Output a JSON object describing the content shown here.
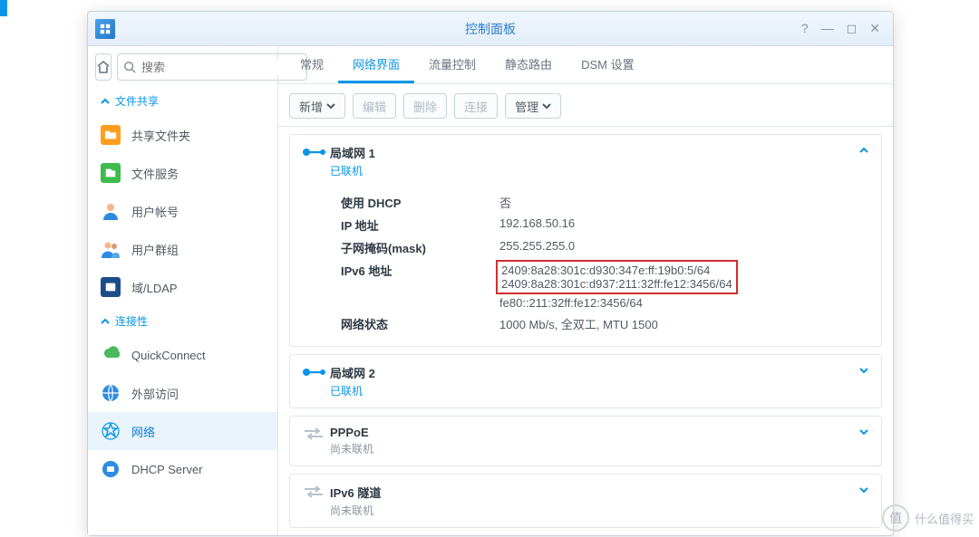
{
  "title": "控制面板",
  "search_placeholder": "搜索",
  "categories": {
    "file_sharing": "文件共享",
    "connectivity": "连接性"
  },
  "sidebar": {
    "shared_folder": "共享文件夹",
    "file_services": "文件服务",
    "user_account": "用户帐号",
    "user_group": "用户群组",
    "domain_ldap": "域/LDAP",
    "quickconnect": "QuickConnect",
    "external_access": "外部访问",
    "network": "网络",
    "dhcp_server": "DHCP Server"
  },
  "tabs": {
    "general": "常规",
    "iface": "网络界面",
    "traffic": "流量控制",
    "static_route": "静态路由",
    "dsm_settings": "DSM 设置"
  },
  "toolbar": {
    "add": "新增",
    "edit": "编辑",
    "delete": "删除",
    "connect": "连接",
    "manage": "管理"
  },
  "lan1": {
    "title": "局域网 1",
    "status": "已联机",
    "labels": {
      "dhcp": "使用 DHCP",
      "ip": "IP 地址",
      "mask": "子网掩码(mask)",
      "ipv6": "IPv6 地址",
      "netstat": "网络状态"
    },
    "dhcp": "否",
    "ip": "192.168.50.16",
    "mask": "255.255.255.0",
    "ipv6_1": "2409:8a28:301c:d930:347e:ff:19b0:5/64",
    "ipv6_2": "2409:8a28:301c:d937:211:32ff:fe12:3456/64",
    "ipv6_3": "fe80::211:32ff:fe12:3456/64",
    "netstat": "1000 Mb/s, 全双工, MTU 1500"
  },
  "lan2": {
    "title": "局域网 2",
    "status": "已联机"
  },
  "pppoe": {
    "title": "PPPoE",
    "status": "尚未联机"
  },
  "ipv6tunnel": {
    "title": "IPv6 隧道",
    "status": "尚未联机"
  },
  "watermark": "什么值得买"
}
